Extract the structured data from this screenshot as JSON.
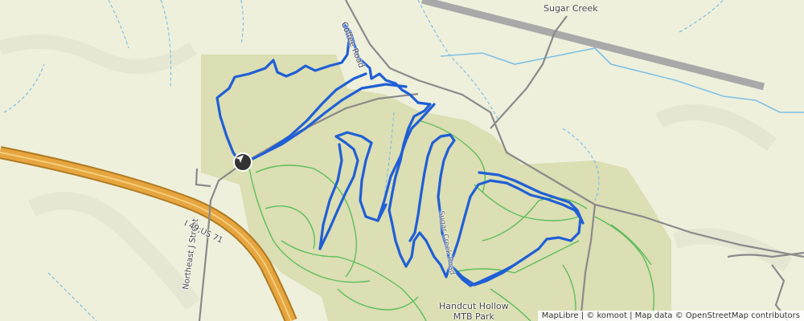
{
  "map": {
    "labels": {
      "sugar_creek": "Sugar Creek",
      "coffee_road": "Coffee Road",
      "northeast_street": "Northeast J Street",
      "highway": "I 49;US 71",
      "park_line1": "Handcut Hollow",
      "park_line2": "MTB Park",
      "small_road": "Sugar Creek Road"
    },
    "attribution": "MapLibre | © komoot | Map data © OpenStreetMap contributors",
    "colors": {
      "background": "#eef0dc",
      "park": "#d9dcae",
      "route": "#1f5fd6",
      "trail": "#5cbf5c",
      "highway_fill": "#e7a540",
      "highway_casing": "#b07a20",
      "road": "#8a8a8a",
      "runway": "#a9a9a9",
      "water": "#7fc0e6"
    },
    "start_marker_icon": "navigation-arrow-icon"
  }
}
